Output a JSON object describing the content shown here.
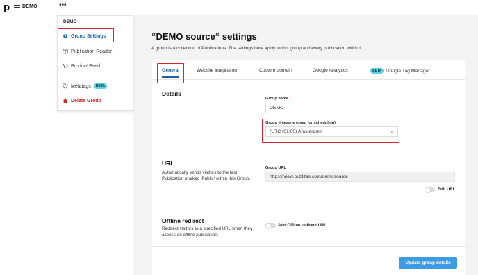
{
  "topbar": {
    "logo": "p",
    "org_name": "DEMO",
    "more": "•••"
  },
  "menu": {
    "header": "DEMO",
    "items": [
      {
        "label": "Group Settings",
        "icon": "gear-icon"
      },
      {
        "label": "Publication Reader",
        "icon": "book-icon"
      },
      {
        "label": "Product Feed",
        "icon": "cart-icon"
      },
      {
        "label": "Metatags",
        "icon": "tag-icon",
        "badge": "BETA"
      },
      {
        "label": "Delete Group",
        "icon": "trash-icon"
      }
    ]
  },
  "page": {
    "title": "“DEMO source“ settings",
    "subtitle": "A group is a collection of Publications. The settings here apply to this group and every publication within it."
  },
  "tabs": [
    {
      "label": "General"
    },
    {
      "label": "Website integration"
    },
    {
      "label": "Custom domain"
    },
    {
      "label": "Google Analytics"
    },
    {
      "label": "Google Tag Manager",
      "badge": "BETA"
    }
  ],
  "details": {
    "title": "Details",
    "group_name_label": "Group name",
    "required_mark": "*",
    "group_name_value": "DEMO",
    "timezone_label": "Group timezone (used for scheduling)",
    "timezone_value": "(UTC+01:00) Amsterdam",
    "chevron": "▼"
  },
  "url": {
    "title": "URL",
    "description": "Automatically sends visitors to the last Publication marked 'Public' within this Group.",
    "group_url_label": "Group URL",
    "group_url_value": "https://view.publitas.com/demosource",
    "edit_toggle_label": "Edit URL"
  },
  "offline": {
    "title": "Offline redirect",
    "description": "Redirect visitors to a specified URL when they access an offline publication.",
    "toggle_label": "Add Offline redirect URL"
  },
  "actions": {
    "update_label": "Update group details"
  },
  "colors": {
    "accent": "#1a6fb0",
    "danger": "#c62828",
    "button": "#3c9be2",
    "highlight": "#d8232a"
  }
}
